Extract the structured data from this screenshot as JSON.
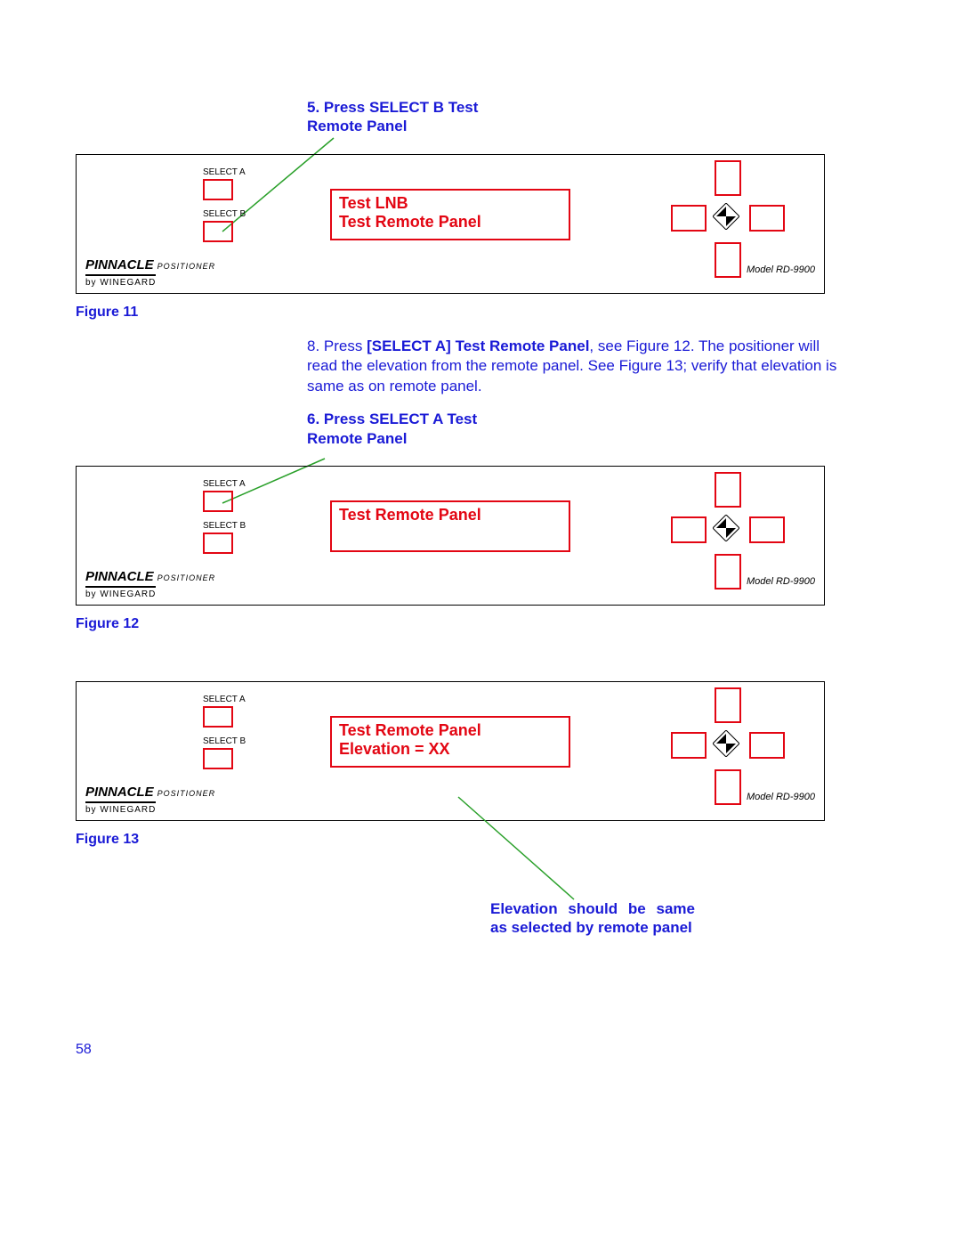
{
  "callout5": "5. Press SELECT B Test Remote Panel",
  "callout6": "6. Press SELECT A Test Remote Panel",
  "step8_pre": "8.   Press ",
  "step8_bold": "[SELECT A] Test Remote Panel",
  "step8_post": ", see Figure 12.  The positioner will read the elevation from the remote panel.  See Figure 13; verify that elevation is same as on remote panel.",
  "bottom_callout": "Elevation should be same as selected by remote panel",
  "panel": {
    "selectA": "SELECT A",
    "selectB": "SELECT B",
    "pinnacle": "PINNACLE",
    "positioner": "POSITIONER",
    "by": "by WINEGARD",
    "model": "Model RD-9900"
  },
  "lcd": {
    "p1_l1": "Test LNB",
    "p1_l2": "Test Remote Panel",
    "p2_l1": "Test Remote Panel",
    "p3_l1": "Test Remote Panel",
    "p3_l2": "Elevation = XX"
  },
  "fig11": "Figure 11",
  "fig12": "Figure 12",
  "fig13": "Figure 13",
  "pagenum": "58"
}
